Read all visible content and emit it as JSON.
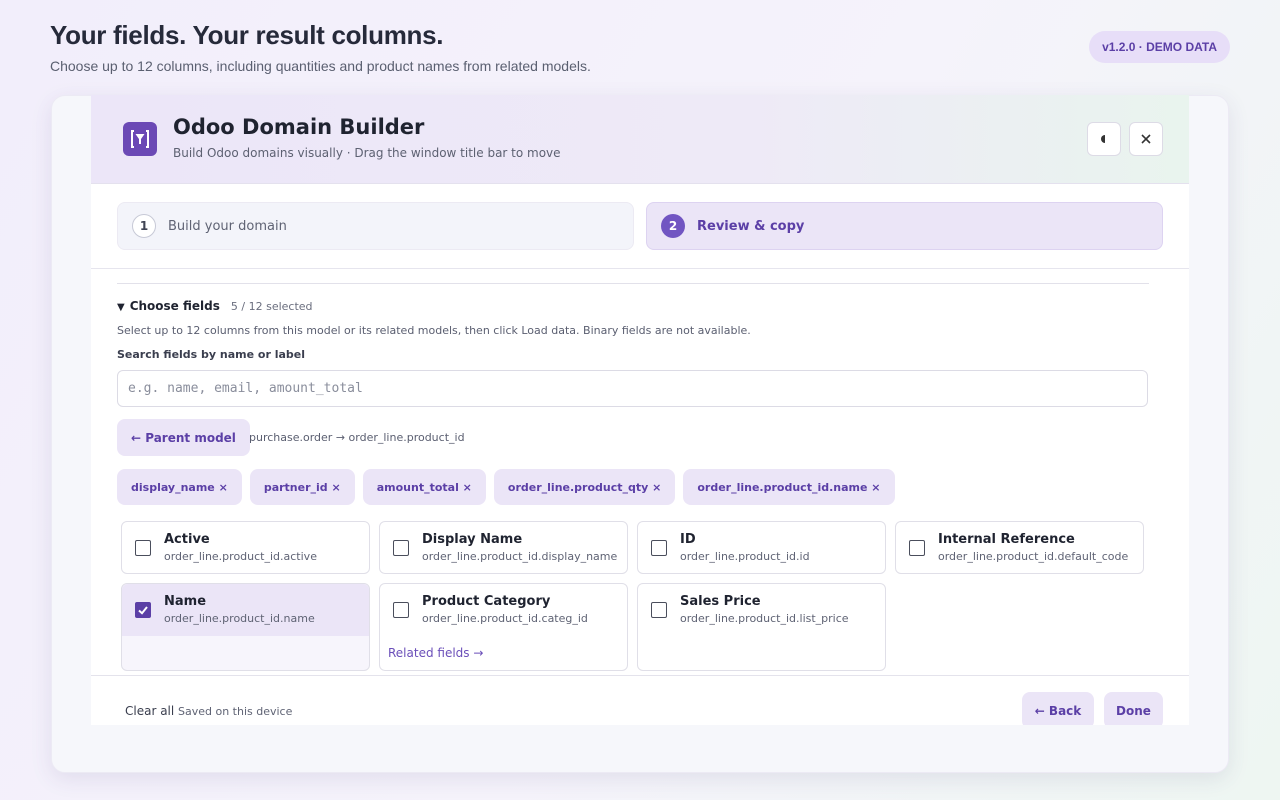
{
  "page": {
    "title": "Your fields. Your result columns.",
    "subtitle": "Choose up to 12 columns, including quantities and product names from related models.",
    "version_badge": "v1.2.0 · DEMO DATA"
  },
  "dialog": {
    "title": "Odoo Domain Builder",
    "subtitle": "Build Odoo domains visually · Drag the window title bar to move",
    "logo_icon": "filter-bracket-icon",
    "theme_button_icon": "half-moon-icon",
    "close_button_icon": "close-icon",
    "accent_color": "#6b49b5"
  },
  "steps": [
    {
      "number": "1",
      "label": "Build your domain",
      "active": false
    },
    {
      "number": "2",
      "label": "Review & copy",
      "active": true
    }
  ],
  "choose_fields": {
    "title": "Choose fields",
    "count": "5 / 12 selected",
    "help": "Select up to 12 columns from this model or its related models, then click Load data. Binary fields are not available.",
    "search_label": "Search fields by name or label",
    "search_placeholder": "e.g. name, email, amount_total",
    "search_value": "",
    "parent_button": "← Parent model",
    "path": "purchase.order → order_line.product_id"
  },
  "selected_chips": [
    "display_name ×",
    "partner_id ×",
    "amount_total ×",
    "order_line.product_qty ×",
    "order_line.product_id.name ×"
  ],
  "fields": [
    {
      "name": "Active",
      "path": "order_line.product_id.active",
      "checked": false
    },
    {
      "name": "Display Name",
      "path": "order_line.product_id.display_name",
      "checked": false
    },
    {
      "name": "ID",
      "path": "order_line.product_id.id",
      "checked": false
    },
    {
      "name": "Internal Reference",
      "path": "order_line.product_id.default_code",
      "checked": false
    },
    {
      "name": "Name",
      "path": "order_line.product_id.name",
      "checked": true
    },
    {
      "name": "Product Category",
      "path": "order_line.product_id.categ_id",
      "checked": false,
      "related_link": "Related fields →"
    },
    {
      "name": "Sales Price",
      "path": "order_line.product_id.list_price",
      "checked": false
    }
  ],
  "footer": {
    "clear_all": "Clear all",
    "saved": "Saved on this device",
    "back": "← Back",
    "done": "Done"
  }
}
